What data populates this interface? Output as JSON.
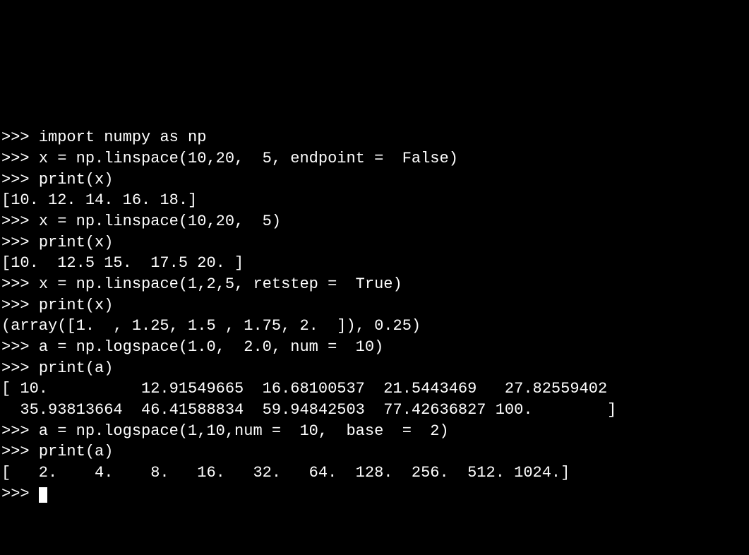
{
  "terminal": {
    "prompt": ">>> ",
    "lines": [
      {
        "type": "input",
        "text": "import numpy as np"
      },
      {
        "type": "input",
        "text": "x = np.linspace(10,20,  5, endpoint =  False)"
      },
      {
        "type": "input",
        "text": "print(x)"
      },
      {
        "type": "output",
        "text": "[10. 12. 14. 16. 18.]"
      },
      {
        "type": "input",
        "text": "x = np.linspace(10,20,  5)"
      },
      {
        "type": "input",
        "text": "print(x)"
      },
      {
        "type": "output",
        "text": "[10.  12.5 15.  17.5 20. ]"
      },
      {
        "type": "input",
        "text": "x = np.linspace(1,2,5, retstep =  True)"
      },
      {
        "type": "input",
        "text": "print(x)"
      },
      {
        "type": "output",
        "text": "(array([1.  , 1.25, 1.5 , 1.75, 2.  ]), 0.25)"
      },
      {
        "type": "input",
        "text": "a = np.logspace(1.0,  2.0, num =  10)"
      },
      {
        "type": "input",
        "text": "print(a)"
      },
      {
        "type": "output",
        "text": "[ 10.          12.91549665  16.68100537  21.5443469   27.82559402"
      },
      {
        "type": "output",
        "text": "  35.93813664  46.41588834  59.94842503  77.42636827 100.        ]"
      },
      {
        "type": "input",
        "text": "a = np.logspace(1,10,num =  10,  base  =  2)"
      },
      {
        "type": "input",
        "text": "print(a)"
      },
      {
        "type": "output",
        "text": "[   2.    4.    8.   16.   32.   64.  128.  256.  512. 1024.]"
      },
      {
        "type": "prompt_only",
        "text": ""
      }
    ]
  }
}
